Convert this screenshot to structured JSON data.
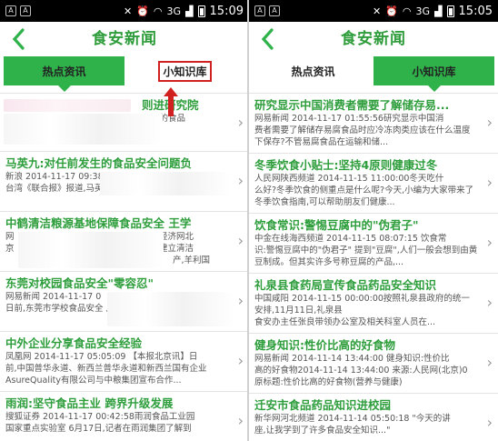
{
  "status_bar": {
    "left_icons": [
      "A",
      "A"
    ],
    "signal_label": "3G",
    "time_left": "15:09",
    "time_right": "15:05"
  },
  "header": {
    "title": "食安新闻",
    "back_icon": "chevron-left-icon"
  },
  "tabs": {
    "hot": "热点资讯",
    "tips": "小知识库"
  },
  "left_list": [
    {
      "title": "",
      "meta": "",
      "snippet": ""
    },
    {
      "title": "马英九:对任前发生的食品安全问题负",
      "meta": "新浪 2014-11-17 09:38",
      "snippet": "台湾《联合报》报道,马英 食品安全问题致歉"
    },
    {
      "title": "中鹤清洁粮源基地保障食品安全 王学",
      "meta": "网",
      "snippet": "京"
    },
    {
      "title": "东莞对校园食品安全\"零容忍\"",
      "meta": "网易新闻 2014-11-17 0",
      "snippet": "日前,东莞市学校食品安全 月11日出台东莞市"
    },
    {
      "title": "中外企业分享食品安全经验",
      "meta": "凤凰网 2014-11-17 05:05:09 【本报北京讯】日",
      "snippet": "前,中国普华永道、新西兰普华永道和新西兰国有企业AsureQuality有限公司与中粮集团宣布合作..."
    },
    {
      "title": "雨润:坚守食品主业 跨界升级发展",
      "meta": "搜狐证券 2014-11-17 00:42:58雨润食品工业园",
      "snippet": "国家重点实验室 6月17日,记者在雨润集团了解到"
    }
  ],
  "left_visible_fragments": {
    "item0_tail": "则进研究院",
    "item0_line": "心的食品",
    "item2_meta_tail": "国经济网北",
    "item2_snippet_tail": "过建立清洁",
    "item2_snippet_end": "产,羊利国",
    "item3_meta_tail": "网易新闻"
  },
  "right_list": [
    {
      "title": "研究显示中国消费者需要了解储存易...",
      "meta": "网易新闻 2014-11-17 01:55:56研究显示中国消",
      "snippet": "费者需要了解储存易腐食品时应冷冻肉类应该在什么温度下保存?不管易腐食品在运输和储..."
    },
    {
      "title": "冬季饮食小贴士:坚持4原则健康过冬",
      "meta": "人民网陕西频道 2014-11-15 11:00:00冬天吃什",
      "snippet": "么好?冬季饮食的侧重点是什么呢?今天,小编为大家带来了冬季饮食指南,可以帮助朋友们健康..."
    },
    {
      "title": "饮食常识:警惕豆腐中的\"伪君子\"",
      "meta": "中金在线海西频道 2014-11-15 08:07:15 饮食常",
      "snippet": "识:警惕豆腐中的\"伪君子\" 提到\"豆腐\",人们一般会想到由黄豆制成。但其实许多号称豆腐的产品,..."
    },
    {
      "title": "礼泉县食药局宣传食品药品安全知识",
      "meta": "中国咸阳 2014-11-15 00:00:00按照礼泉县政府的统一安排,11月11日,礼泉县",
      "snippet": "食安办主任张良带领办公室及相关科室人员在..."
    },
    {
      "title": "健身知识:性价比高的好食物",
      "meta": "网易新闻 2014-11-14 13:44:00 健身知识:性价比",
      "snippet": "高的好食物2014-11-14 13:44:00 来源:人民网(北京)0 原标题:性价比高的好食物(营养与健康)"
    },
    {
      "title": "迁安市食品药品知识进校园",
      "meta": "新华网河北频道 2014-11-14 05:50:18 \"今天的讲",
      "snippet": "座,让我学到了许多食品安全知识...\""
    }
  ],
  "colors": {
    "accent": "#2fb24a",
    "title_green": "#2e9e3c",
    "highlight_red": "#d12020"
  }
}
